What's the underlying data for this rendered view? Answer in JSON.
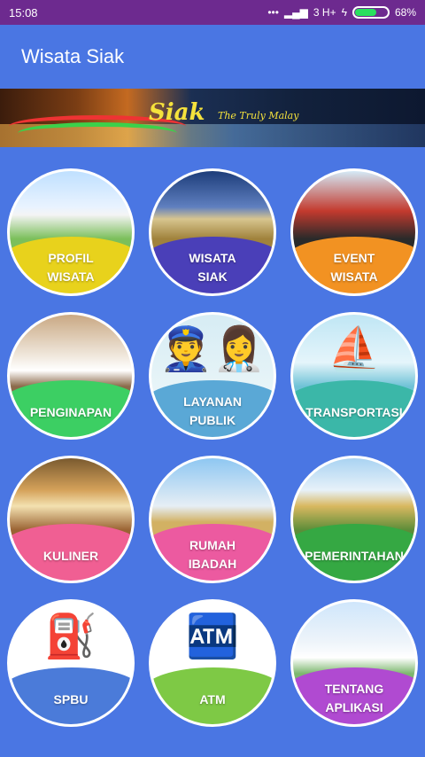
{
  "status_bar": {
    "time": "15:08",
    "signal": "3 H+",
    "battery": "68%",
    "battery_level": 0.68
  },
  "app_bar": {
    "title": "Wisata Siak"
  },
  "banner": {
    "title": "Siak",
    "subtitle": "The Truly Malay"
  },
  "tiles": [
    {
      "line1": "PROFIL",
      "line2": "WISATA",
      "color": "#e8d21c",
      "pic": "palace"
    },
    {
      "line1": "WISATA",
      "line2": "SIAK",
      "color": "#4a3fb8",
      "pic": "bridge"
    },
    {
      "line1": "EVENT",
      "line2": "WISATA",
      "color": "#f29222",
      "pic": "cycling"
    },
    {
      "line1": "PENGINAPAN",
      "line2": "",
      "color": "#3ccf63",
      "pic": "hotel"
    },
    {
      "line1": "LAYANAN",
      "line2": "PUBLIK",
      "color": "#5aa8d6",
      "pic": "officers"
    },
    {
      "line1": "TRANSPORTASI",
      "line2": "",
      "color": "#3bb7a8",
      "pic": "ship"
    },
    {
      "line1": "KULINER",
      "line2": "",
      "color": "#f05f93",
      "pic": "food"
    },
    {
      "line1": "RUMAH",
      "line2": "IBADAH",
      "color": "#ec5aa0",
      "pic": "mosque"
    },
    {
      "line1": "PEMERINTAHAN",
      "line2": "",
      "color": "#35a843",
      "pic": "government"
    },
    {
      "line1": "SPBU",
      "line2": "",
      "color": "#4b7bd9",
      "pic": "fuel"
    },
    {
      "line1": "ATM",
      "line2": "",
      "color": "#7ec945",
      "pic": "atm"
    },
    {
      "line1": "TENTANG",
      "line2": "APLIKASI",
      "color": "#b04ad1",
      "pic": "palace2"
    }
  ]
}
